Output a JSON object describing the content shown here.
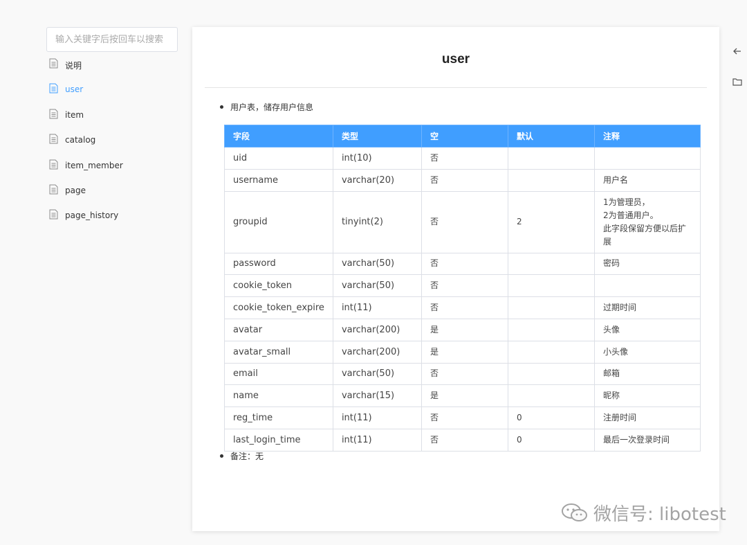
{
  "search": {
    "placeholder": "输入关键字后按回车以搜索"
  },
  "sidebar": {
    "items": [
      {
        "label": "说明"
      },
      {
        "label": "user"
      },
      {
        "label": "item"
      },
      {
        "label": "catalog"
      },
      {
        "label": "item_member"
      },
      {
        "label": "page"
      },
      {
        "label": "page_history"
      }
    ]
  },
  "page": {
    "title": "user",
    "description": "用户表，储存用户信息",
    "remark": "备注：无"
  },
  "table": {
    "headers": [
      "字段",
      "类型",
      "空",
      "默认",
      "注释"
    ],
    "rows": [
      [
        "uid",
        "int(10)",
        "否",
        "",
        ""
      ],
      [
        "username",
        "varchar(20)",
        "否",
        "",
        "用户名"
      ],
      [
        "groupid",
        "tinyint(2)",
        "否",
        "2",
        "1为管理员，\n2为普通用户。\n此字段保留方便以后扩展"
      ],
      [
        "password",
        "varchar(50)",
        "否",
        "",
        "密码"
      ],
      [
        "cookie_token",
        "varchar(50)",
        "否",
        "",
        ""
      ],
      [
        "cookie_token_expire",
        "int(11)",
        "否",
        "",
        "过期时间"
      ],
      [
        "avatar",
        "varchar(200)",
        "是",
        "",
        "头像"
      ],
      [
        "avatar_small",
        "varchar(200)",
        "是",
        "",
        "小头像"
      ],
      [
        "email",
        "varchar(50)",
        "否",
        "",
        "邮箱"
      ],
      [
        "name",
        "varchar(15)",
        "是",
        "",
        "昵称"
      ],
      [
        "reg_time",
        "int(11)",
        "否",
        "0",
        "注册时间"
      ],
      [
        "last_login_time",
        "int(11)",
        "否",
        "0",
        "最后一次登录时间"
      ]
    ]
  },
  "right_icons": [
    "arrow-left-icon",
    "folder-icon"
  ],
  "watermark": {
    "text": "微信号: libotest"
  },
  "colors": {
    "accent": "#409eff"
  }
}
